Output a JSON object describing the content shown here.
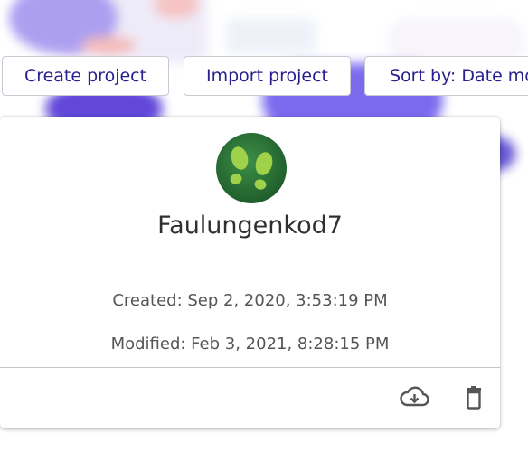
{
  "toolbar": {
    "create_label": "Create project",
    "import_label": "Import project",
    "sort_label": "Sort by: Date modified"
  },
  "project_card": {
    "name": "Faulungenkod7",
    "created": "Created: Sep 2, 2020, 3:53:19 PM",
    "modified": "Modified: Feb 3, 2021, 8:28:15 PM",
    "avatar_icon": "footprints-icon",
    "actions": {
      "download_icon": "cloud-download-icon",
      "delete_icon": "trash-icon"
    }
  },
  "colors": {
    "button_text": "#2a1e8f",
    "avatar_bg": "#2f7a3a",
    "avatar_feet": "#9fd24a",
    "icon": "#555555"
  }
}
